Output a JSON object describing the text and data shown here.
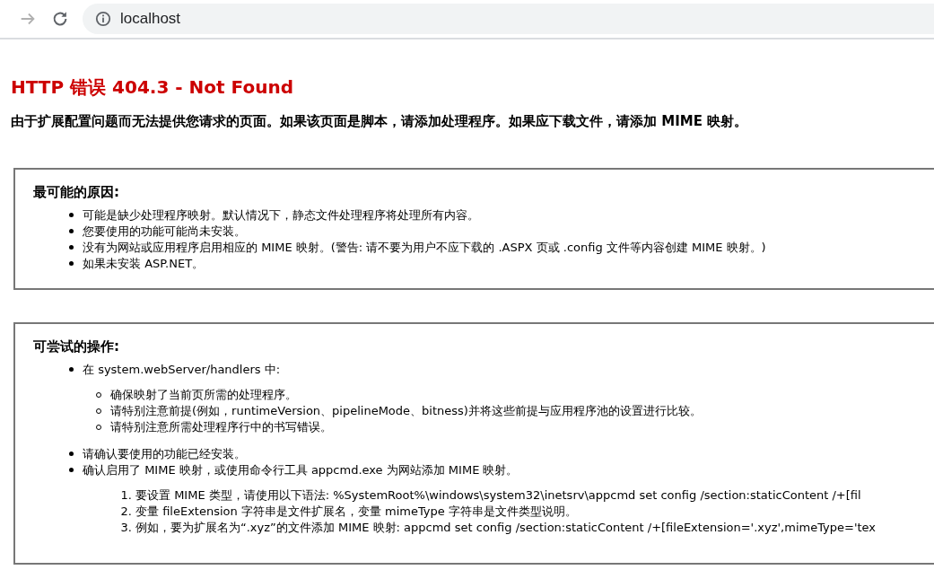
{
  "browser": {
    "forward_disabled": true,
    "url": "localhost"
  },
  "error": {
    "title": "HTTP 错误 404.3 - Not Found",
    "summary": "由于扩展配置问题而无法提供您请求的页面。如果该页面是脚本，请添加处理程序。如果应下载文件，请添加 MIME 映射。"
  },
  "sections": [
    {
      "heading": "最可能的原因:",
      "items": [
        {
          "text": "可能是缺少处理程序映射。默认情况下，静态文件处理程序将处理所有内容。"
        },
        {
          "text": "您要使用的功能可能尚未安装。"
        },
        {
          "text": "没有为网站或应用程序启用相应的 MIME 映射。(警告: 请不要为用户不应下载的 .ASPX 页或 .config 文件等内容创建 MIME 映射。)"
        },
        {
          "text": "如果未安装 ASP.NET。"
        }
      ]
    },
    {
      "heading": "可尝试的操作:",
      "items": [
        {
          "text": "在 system.webServer/handlers 中:",
          "children": [
            {
              "text": "确保映射了当前页所需的处理程序。"
            },
            {
              "text": "请特别注意前提(例如，runtimeVersion、pipelineMode、bitness)并将这些前提与应用程序池的设置进行比较。"
            },
            {
              "text": "请特别注意所需处理程序行中的书写错误。"
            }
          ]
        },
        {
          "text": "请确认要使用的功能已经安装。"
        },
        {
          "text": "确认启用了 MIME 映射，或使用命令行工具 appcmd.exe 为网站添加 MIME 映射。",
          "steps": [
            {
              "number": "1.",
              "text": "要设置 MIME 类型，请使用以下语法: %SystemRoot%\\windows\\system32\\inetsrv\\appcmd set config /section:staticContent /+[fil"
            },
            {
              "number": "2.",
              "text": "变量 fileExtension 字符串是文件扩展名，变量 mimeType 字符串是文件类型说明。"
            },
            {
              "number": "3.",
              "text": "例如，要为扩展名为“.xyz”的文件添加 MIME 映射: appcmd set config /section:staticContent /+[fileExtension='.xyz',mimeType='tex"
            }
          ]
        }
      ]
    }
  ]
}
